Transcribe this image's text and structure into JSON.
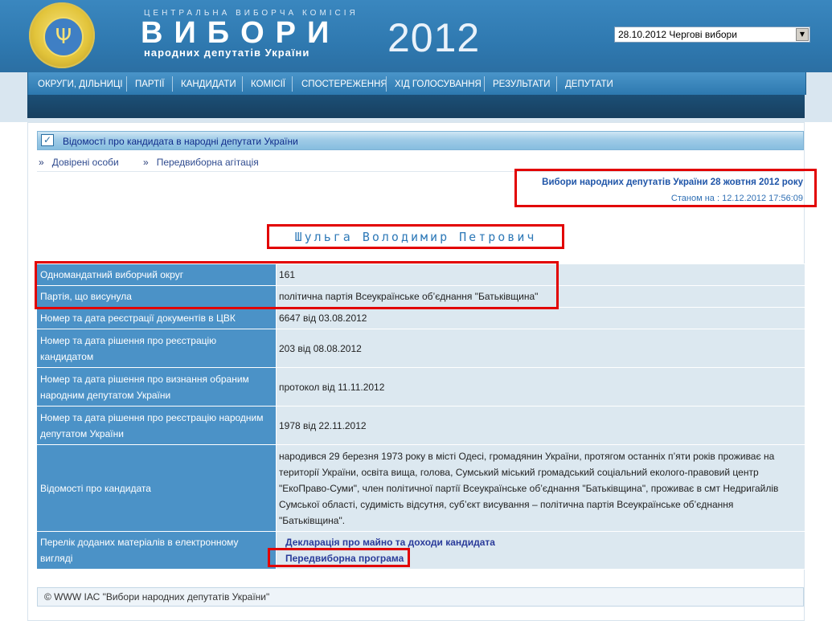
{
  "header": {
    "cvk_label": "ЦЕНТРАЛЬНА ВИБОРЧА КОМІСІЯ",
    "title": "ВИБОРИ",
    "subtitle": "народних депутатів України",
    "year": "2012",
    "election_select": "28.10.2012 Чергові вибори"
  },
  "nav": {
    "items": [
      "ОКРУГИ, ДІЛЬНИЦІ",
      "ПАРТІЇ",
      "КАНДИДАТИ",
      "КОМІСІЇ",
      "СПОСТЕРЕЖЕННЯ",
      "ХІД ГОЛОСУВАННЯ",
      "РЕЗУЛЬТАТИ",
      "ДЕПУТАТИ"
    ]
  },
  "section": {
    "title": "Відомості про кандидата в народні депутати України"
  },
  "links": {
    "bullet": "»",
    "trusted": "Довірені особи",
    "campaign": "Передвиборна агітація"
  },
  "election_info": {
    "title": "Вибори народних депутатів України 28 жовтня 2012 року",
    "status": "Станом на : 12.12.2012 17:56:09"
  },
  "candidate": {
    "name": "Шульга Володимир Петрович"
  },
  "rows": [
    {
      "label": "Одномандатний виборчий округ",
      "value": "161"
    },
    {
      "label": "Партія, що висунула",
      "value": "політична партія Всеукраїнське об’єднання \"Батьківщина\""
    },
    {
      "label": "Номер та дата реєстрації документів в ЦВК",
      "value": "6647 від 03.08.2012"
    },
    {
      "label": "Номер та дата рішення про реєстрацію кандидатом",
      "value": "203 від 08.08.2012"
    },
    {
      "label": "Номер та дата рішення про визнання обраним народним депутатом України",
      "value": "протокол від 11.11.2012"
    },
    {
      "label": "Номер та дата рішення про реєстрацію народним депутатом України",
      "value": "1978 від 22.11.2012"
    },
    {
      "label": "Відомості про кандидата",
      "value": "народився 29 березня 1973 року в місті Одесі, громадянин України, протягом останніх п’яти років проживає на території України, освіта вища, голова, Сумський міський громадський соціальний еколого-правовий центр \"ЕкоПраво-Суми\", член політичної партії Всеукраїнське об’єднання \"Батьківщина\", проживає в смт Недригайлів Сумської області, судимість відсутня, суб’єкт висування – політична партія Всеукраїнське об’єднання \"Батьківщина\"."
    },
    {
      "label": "Перелік доданих матеріалів в електронному вигляді",
      "value": ""
    }
  ],
  "materials": {
    "declaration": "Декларація про майно та доходи кандидата",
    "program": "Передвиборна програма"
  },
  "footer": {
    "text": "© WWW ІАС \"Вибори народних депутатів України\""
  }
}
